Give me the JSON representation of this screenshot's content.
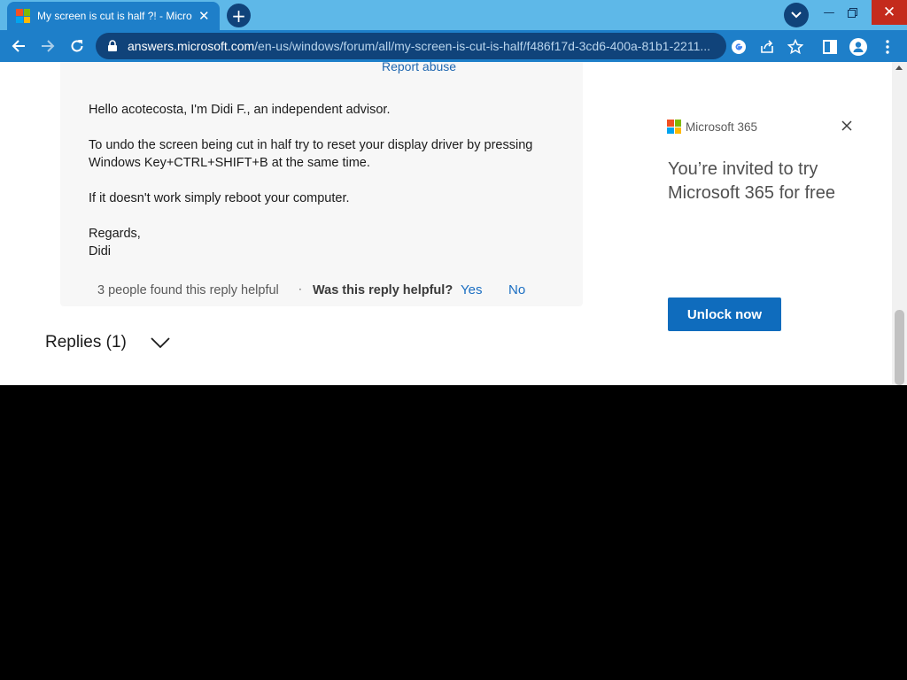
{
  "browser": {
    "tab": {
      "title": "My screen is cut is half ?! - Micro"
    },
    "url": {
      "host": "answers.microsoft.com",
      "path": "/en-us/windows/forum/all/my-screen-is-cut-is-half/f486f17d-3cd6-400a-81b1-2211..."
    }
  },
  "post": {
    "report_abuse": "Report abuse",
    "paragraphs": [
      "Hello acotecosta, I'm Didi F., an independent advisor.",
      "To undo the screen being cut in half try to reset your display driver by pressing",
      "Windows Key+CTRL+SHIFT+B at the same time.",
      "If it doesn't work simply reboot your computer.",
      "Regards,",
      "Didi"
    ],
    "helpful_count": "3 people found this reply helpful",
    "separator": "·",
    "helpful_question": "Was this reply helpful?",
    "yes": "Yes",
    "no": "No"
  },
  "replies": {
    "label": "Replies (1)"
  },
  "ad": {
    "brand": "Microsoft 365",
    "headline_1": "You’re invited to try",
    "headline_2": "Microsoft 365 for free",
    "cta": "Unlock now"
  },
  "colors": {
    "ms_red": "#f25022",
    "ms_green": "#7fba00",
    "ms_blue": "#00a4ef",
    "ms_yellow": "#ffb900",
    "link": "#1b6ec2",
    "cta": "#0f6cbd"
  }
}
